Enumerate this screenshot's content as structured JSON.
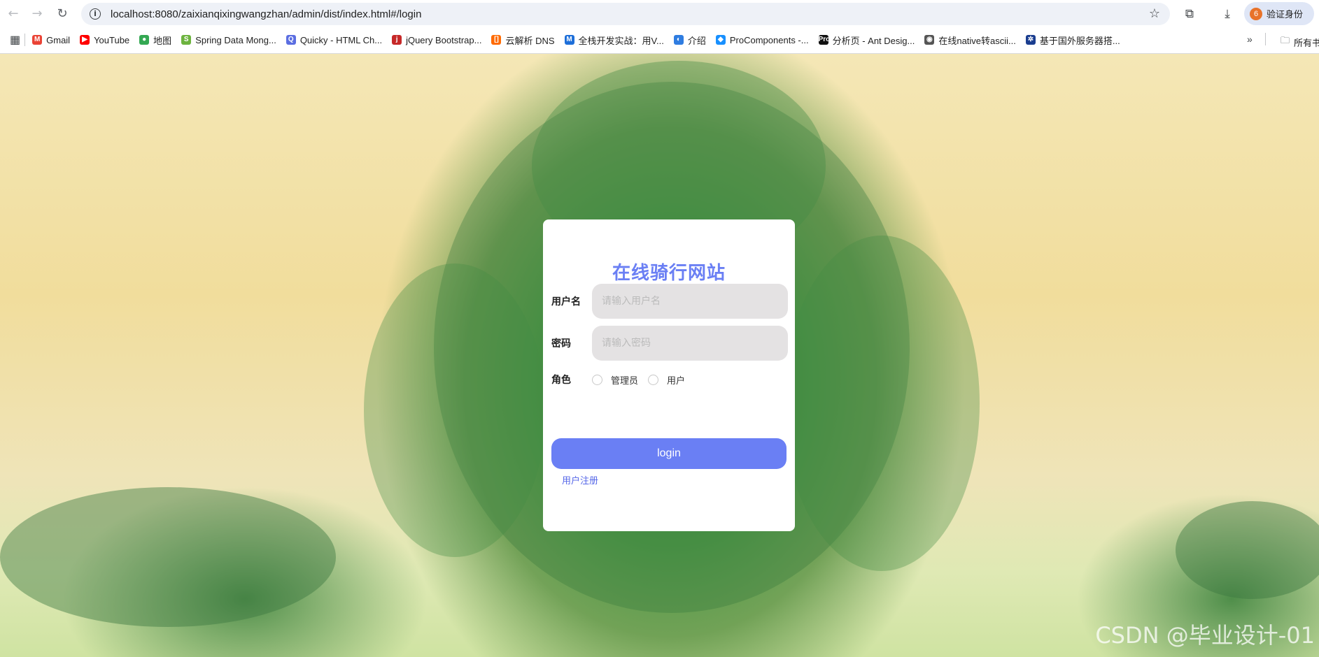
{
  "browser": {
    "url": "localhost:8080/zaixianqixingwangzhan/admin/dist/index.html#/login",
    "profile_label": "验证身份",
    "bookmarks": [
      {
        "label": "Gmail",
        "color": "#ea4335",
        "glyph": "M"
      },
      {
        "label": "YouTube",
        "color": "#ff0000",
        "glyph": "▶"
      },
      {
        "label": "地图",
        "color": "#34a853",
        "glyph": "●"
      },
      {
        "label": "Spring Data Mong...",
        "color": "#6db33f",
        "glyph": "S"
      },
      {
        "label": "Quicky - HTML Ch...",
        "color": "#5b6ee1",
        "glyph": "Q"
      },
      {
        "label": "jQuery Bootstrap...",
        "color": "#c62828",
        "glyph": "j"
      },
      {
        "label": "云解析 DNS",
        "color": "#ff6a00",
        "glyph": "[]"
      },
      {
        "label": "全栈开发实战：用V...",
        "color": "#1e6fd9",
        "glyph": "M"
      },
      {
        "label": "介绍",
        "color": "#2f7de1",
        "glyph": "◐"
      },
      {
        "label": "ProComponents -...",
        "color": "#1890ff",
        "glyph": "◆"
      },
      {
        "label": "分析页 - Ant Desig...",
        "color": "#111111",
        "glyph": "Pro"
      },
      {
        "label": "在线native转ascii...",
        "color": "#555555",
        "glyph": "◉"
      },
      {
        "label": "基于国外服务器搭...",
        "color": "#1a3d8f",
        "glyph": "✲"
      }
    ],
    "all_bookmarks_label": "所有书"
  },
  "login": {
    "title": "在线骑行网站",
    "username_label": "用户名",
    "username_placeholder": "请输入用户名",
    "password_label": "密码",
    "password_placeholder": "请输入密码",
    "role_label": "角色",
    "roles": [
      "管理员",
      "用户"
    ],
    "login_button": "login",
    "register_link": "用户注册"
  },
  "watermark": "CSDN @毕业设计-01"
}
